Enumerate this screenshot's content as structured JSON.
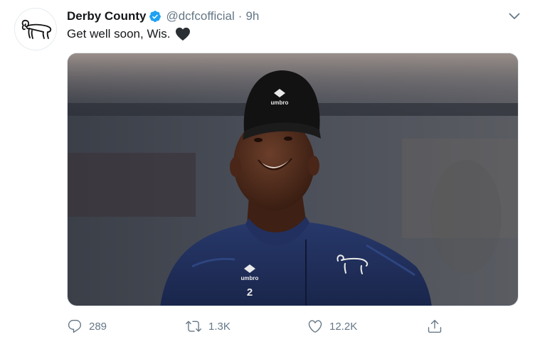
{
  "tweet": {
    "display_name": "Derby County",
    "handle": "@dcfcofficial",
    "separator": "·",
    "time": "9h",
    "text": "Get well soon, Wis.",
    "emoji": "black-heart",
    "media": {
      "beanie_brand": "umbro",
      "shirt_brand": "umbro",
      "shirt_number": "2"
    }
  },
  "actions": {
    "replies": "289",
    "retweets": "1.3K",
    "likes": "12.2K"
  },
  "icons": {
    "avatar": "derby-ram-logo",
    "verified": "verified-badge-icon",
    "caret": "chevron-down-icon",
    "reply": "reply-icon",
    "retweet": "retweet-icon",
    "like": "heart-icon",
    "share": "share-icon"
  },
  "colors": {
    "verified_blue": "#1da1f2",
    "muted_text": "#657786",
    "primary_text": "#14171a",
    "jacket_navy": "#1c2a55"
  }
}
